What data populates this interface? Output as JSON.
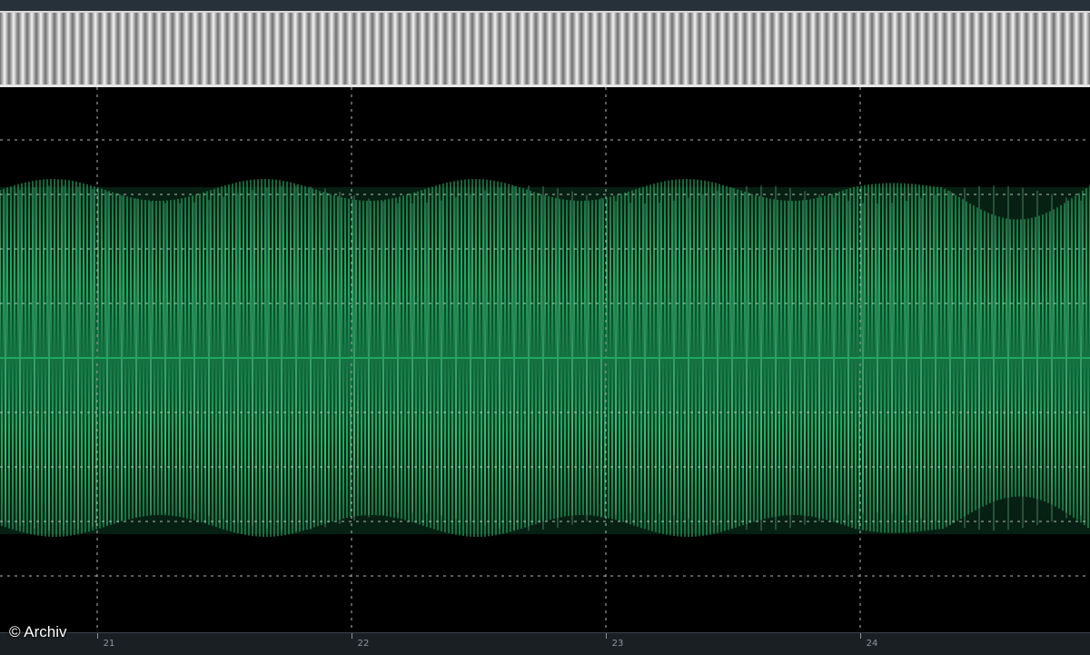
{
  "credit": "© Archiv",
  "ruler": {
    "labels": [
      "21",
      "22",
      "23",
      "24"
    ]
  },
  "colors": {
    "trace": "#1fa861",
    "trace_bright": "#9ff2c0",
    "grid": "#d9d9d9",
    "background": "#000000",
    "pulse_bar": "#cfcfcf"
  }
}
